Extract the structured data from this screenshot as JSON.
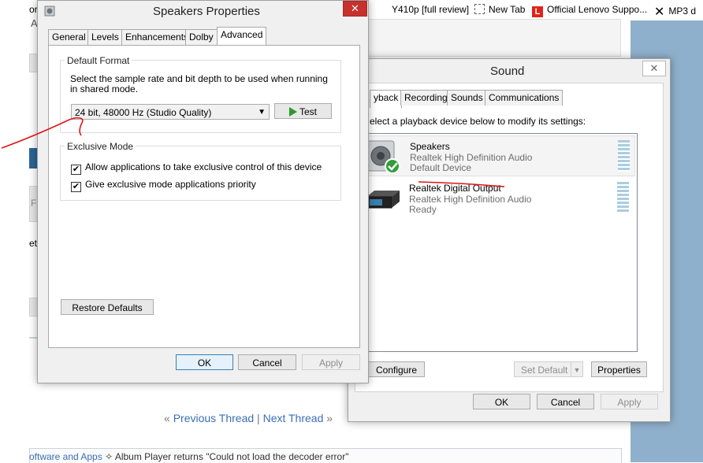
{
  "browser": {
    "bookmarks": [
      {
        "label": "Y410p [full review]"
      },
      {
        "label": "New Tab"
      },
      {
        "label": "Official Lenovo Suppo..."
      },
      {
        "label": "MP3 d"
      }
    ],
    "left_fragments": [
      "or",
      "A",
      "F",
      "et"
    ],
    "thread_nav": {
      "prefix": "«",
      "previous": "Previous Thread",
      "sep": "|",
      "next": "Next Thread",
      "suffix": "»"
    },
    "breadcrumb": {
      "link": "oftware and Apps",
      "sep": "✧",
      "text": "Album Player returns \"Could not load the decoder error\""
    }
  },
  "speakers_props": {
    "title": "Speakers Properties",
    "close_label": "✕",
    "tabs": [
      {
        "label": "General"
      },
      {
        "label": "Levels"
      },
      {
        "label": "Enhancements"
      },
      {
        "label": "Dolby"
      },
      {
        "label": "Advanced"
      }
    ],
    "default_format": {
      "title": "Default Format",
      "description": "Select the sample rate and bit depth to be used when running in shared mode.",
      "selected": "24 bit, 48000 Hz (Studio Quality)",
      "test_label": "Test"
    },
    "exclusive_mode": {
      "title": "Exclusive Mode",
      "options": [
        {
          "label": "Allow applications to take exclusive control of this device",
          "checked": true
        },
        {
          "label": "Give exclusive mode applications priority",
          "checked": true
        }
      ]
    },
    "restore_label": "Restore Defaults",
    "ok_label": "OK",
    "cancel_label": "Cancel",
    "apply_label": "Apply"
  },
  "sound": {
    "title": "Sound",
    "close_label": "✕",
    "tabs": [
      {
        "label": "yback"
      },
      {
        "label": "Recording"
      },
      {
        "label": "Sounds"
      },
      {
        "label": "Communications"
      }
    ],
    "instruction": "elect a playback device below to modify its settings:",
    "devices": [
      {
        "name": "Speakers",
        "driver": "Realtek High Definition Audio",
        "status": "Default Device"
      },
      {
        "name": "Realtek Digital Output",
        "driver": "Realtek High Definition Audio",
        "status": "Ready"
      }
    ],
    "configure_label": "Configure",
    "set_default_label": "Set Default",
    "properties_label": "Properties",
    "ok_label": "OK",
    "cancel_label": "Cancel",
    "apply_label": "Apply"
  },
  "colors": {
    "annotation": "#e0141a",
    "accent": "#3c7fb1",
    "desktop_right": "#8fb0cc"
  }
}
